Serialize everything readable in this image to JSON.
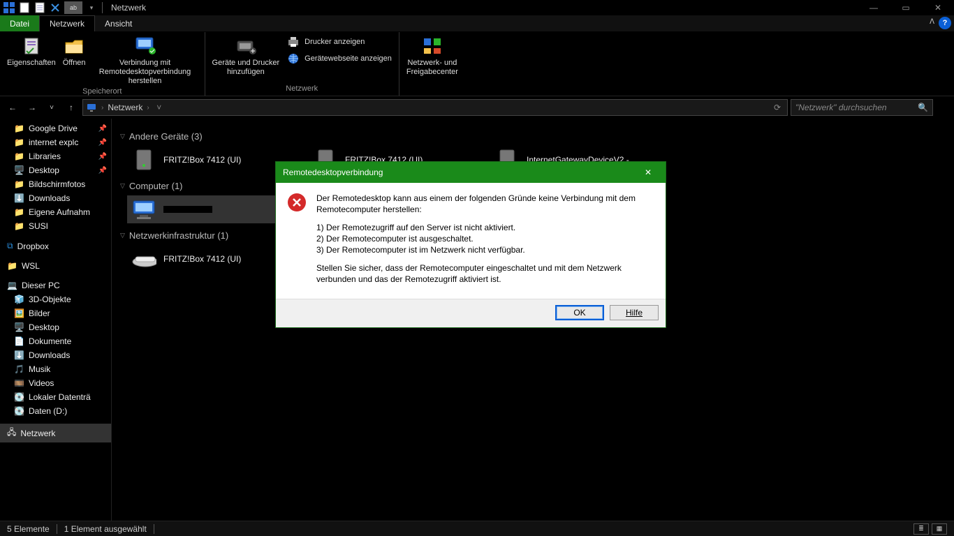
{
  "window": {
    "title": "Netzwerk"
  },
  "window_controls": {
    "min": "—",
    "max": "▭",
    "close": "✕"
  },
  "tabs": {
    "file": "Datei",
    "network": "Netzwerk",
    "view": "Ansicht",
    "collapse": "ᐱ",
    "help": "?"
  },
  "ribbon": {
    "properties": "Eigenschaften",
    "open": "Öffnen",
    "remote": "Verbindung mit\nRemotedesktopverbindung herstellen",
    "group_location": "Speicherort",
    "add_devices": "Geräte und Drucker\nhinzufügen",
    "show_printers": "Drucker anzeigen",
    "show_device_web": "Gerätewebseite anzeigen",
    "group_network": "Netzwerk",
    "sharing_center": "Netzwerk- und\nFreigabecenter"
  },
  "navbar": {
    "back": "←",
    "fwd": "→",
    "recent": "˅",
    "up": "↑",
    "crumb0": "Netzwerk",
    "chev": "›",
    "drop": "˅",
    "refresh": "⟳"
  },
  "search": {
    "placeholder": "\"Netzwerk\" durchsuchen"
  },
  "tree": {
    "google_drive": "Google Drive",
    "internet_explc": "internet explc",
    "libraries": "Libraries",
    "desktop_pin": "Desktop",
    "bildschirmfotos": "Bildschirmfotos",
    "downloads_pin": "Downloads",
    "eigene_aufnahm": "Eigene Aufnahm",
    "susi": "SUSI",
    "dropbox": "Dropbox",
    "wsl": "WSL",
    "this_pc": "Dieser PC",
    "3d_objekte": "3D-Objekte",
    "bilder": "Bilder",
    "desktop": "Desktop",
    "dokumente": "Dokumente",
    "downloads": "Downloads",
    "musik": "Musik",
    "videos": "Videos",
    "lokaler": "Lokaler Datenträ",
    "daten_d": "Daten (D:)",
    "netzwerk": "Netzwerk"
  },
  "content": {
    "other_devices_hdr": "Andere Geräte (3)",
    "computer_hdr": "Computer (1)",
    "infra_hdr": "Netzwerkinfrastruktur (1)",
    "fritz1": "FRITZ!Box 7412 (UI)",
    "fritz2": "FRITZ!Box 7412 (UI)",
    "gateway": "InternetGatewayDeviceV2 -",
    "computer1": "",
    "fritz_router": "FRITZ!Box 7412 (UI)"
  },
  "status": {
    "count": "5 Elemente",
    "selected": "1 Element ausgewählt"
  },
  "dialog": {
    "title": "Remotedesktopverbindung",
    "p1": "Der Remotedesktop kann aus einem der folgenden Gründe keine Verbindung mit dem Remotecomputer herstellen:",
    "r1": "1) Der Remotezugriff auf den Server ist nicht aktiviert.",
    "r2": "2) Der Remotecomputer ist ausgeschaltet.",
    "r3": "3) Der Remotecomputer ist im Netzwerk nicht verfügbar.",
    "p2": "Stellen Sie sicher, dass der Remotecomputer eingeschaltet und mit dem Netzwerk verbunden und das der Remotezugriff aktiviert ist.",
    "ok": "OK",
    "help": "Hilfe"
  }
}
